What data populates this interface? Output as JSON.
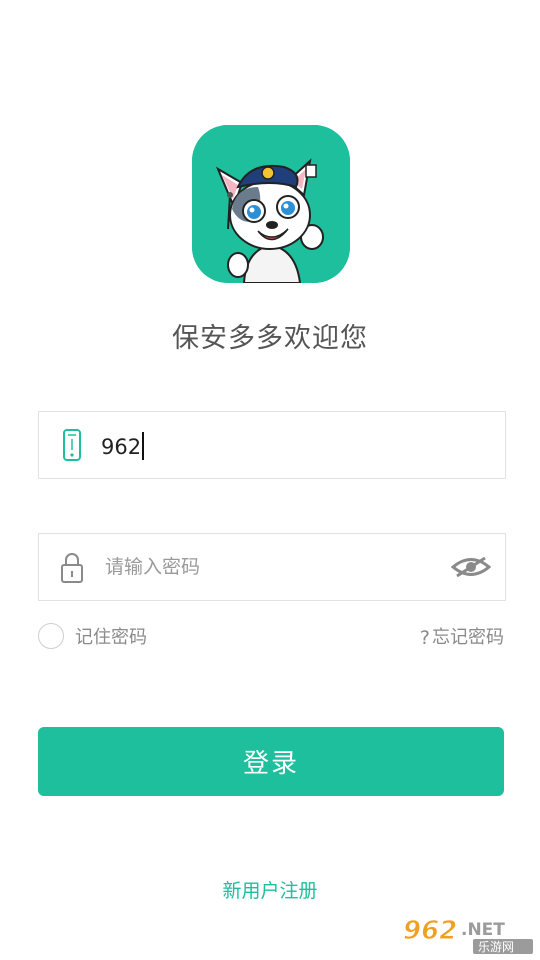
{
  "app": {
    "logo_icon": "dog-mascot-icon",
    "welcome_text": "保安多多欢迎您"
  },
  "phone_field": {
    "icon": "phone-icon",
    "value": "962"
  },
  "password_field": {
    "icon": "lock-icon",
    "placeholder": "请输入密码",
    "toggle_icon": "eye-icon"
  },
  "options": {
    "remember_label": "记住密码",
    "forgot_icon": "question-icon",
    "forgot_label": "忘记密码"
  },
  "actions": {
    "login_label": "登录",
    "register_label": "新用户注册"
  },
  "watermark": {
    "brand": "962",
    "suffix": ".NET",
    "subtitle": "乐游网"
  },
  "colors": {
    "accent": "#1dbf9d",
    "text_gray": "#8a8a8a"
  }
}
